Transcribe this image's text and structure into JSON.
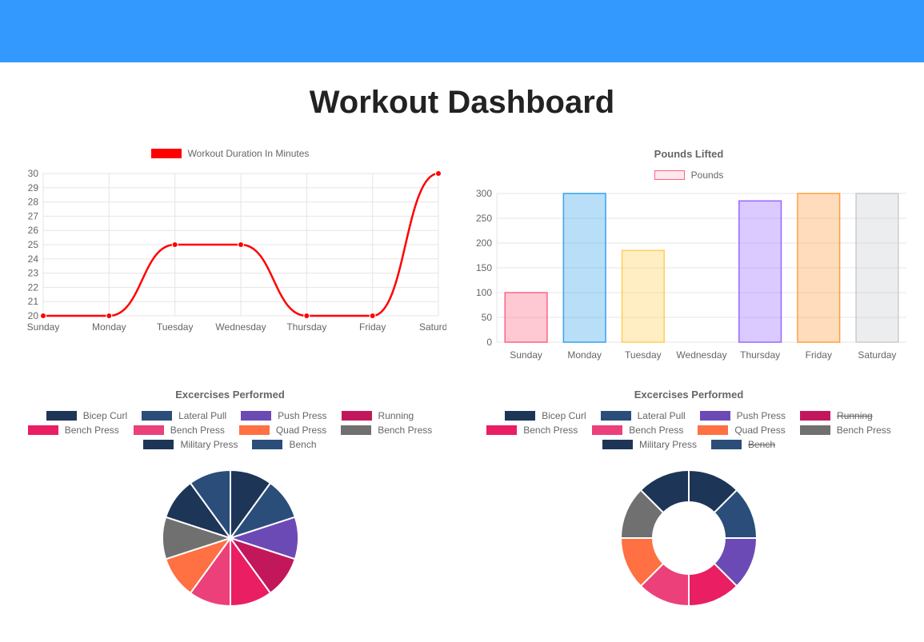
{
  "page": {
    "title": "Workout Dashboard"
  },
  "chart_data": [
    {
      "id": "duration_line",
      "type": "line",
      "title": "",
      "legend": "Workout Duration In Minutes",
      "legend_color": "#ff0000",
      "categories": [
        "Sunday",
        "Monday",
        "Tuesday",
        "Wednesday",
        "Thursday",
        "Friday",
        "Saturday"
      ],
      "values": [
        20,
        20,
        25,
        25,
        20,
        20,
        30
      ],
      "ylim": [
        20,
        30
      ],
      "yticks": [
        20,
        21,
        22,
        23,
        24,
        25,
        26,
        27,
        28,
        29,
        30
      ],
      "line_color": "#ff0000",
      "point_color": "#ff0000",
      "grid": true
    },
    {
      "id": "pounds_bar",
      "type": "bar",
      "title": "Pounds Lifted",
      "legend": "Pounds",
      "categories": [
        "Sunday",
        "Monday",
        "Tuesday",
        "Wednesday",
        "Thursday",
        "Friday",
        "Saturday"
      ],
      "values": [
        100,
        300,
        185,
        0,
        285,
        300,
        300
      ],
      "ylim": [
        0,
        300
      ],
      "yticks": [
        0,
        50,
        100,
        150,
        200,
        250,
        300
      ],
      "bar_colors": [
        "#ff6384",
        "#36a2eb",
        "#ffce56",
        "#4bc0c0",
        "#9966ff",
        "#ff9f40",
        "#c9cbcf"
      ],
      "grid": true
    },
    {
      "id": "exercises_pie",
      "type": "pie",
      "title": "Excercises Performed",
      "labels": [
        "Bicep Curl",
        "Lateral Pull",
        "Push Press",
        "Running",
        "Bench Press",
        "Bench Press",
        "Quad Press",
        "Bench Press",
        "Military Press",
        "Bench"
      ],
      "values": [
        1,
        1,
        1,
        1,
        1,
        1,
        1,
        1,
        1,
        1
      ],
      "colors": [
        "#1d3557",
        "#2a4d7a",
        "#6c4ab6",
        "#c2185b",
        "#e91e63",
        "#ec407a",
        "#ff7043",
        "#707070",
        "#1d3557",
        "#2a4d7a"
      ]
    },
    {
      "id": "exercises_doughnut",
      "type": "pie",
      "variant": "doughnut",
      "title": "Excercises Performed",
      "labels": [
        "Bicep Curl",
        "Lateral Pull",
        "Push Press",
        "Running",
        "Bench Press",
        "Bench Press",
        "Quad Press",
        "Bench Press",
        "Military Press",
        "Bench"
      ],
      "values": [
        1,
        1,
        1,
        1,
        1,
        1,
        1,
        1,
        1,
        1
      ],
      "hidden": [
        "Running",
        "Bench"
      ],
      "colors": [
        "#1d3557",
        "#2a4d7a",
        "#6c4ab6",
        "#c2185b",
        "#e91e63",
        "#ec407a",
        "#ff7043",
        "#707070",
        "#1d3557",
        "#2a4d7a"
      ]
    }
  ]
}
